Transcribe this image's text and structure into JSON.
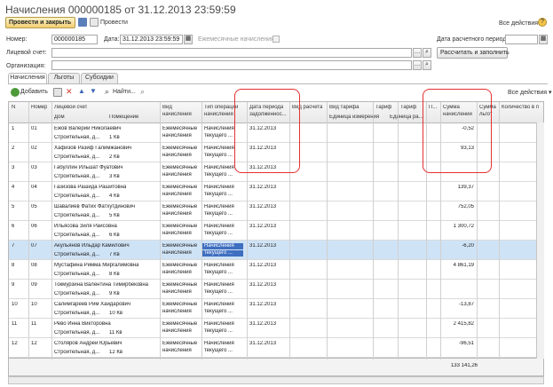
{
  "window": {
    "title": "Начисления 000000185 от 31.12.2013 23:59:59"
  },
  "toolbar": {
    "post_close": "Провести и закрыть",
    "post": "Провести",
    "all_actions": "Все действия ▾",
    "help": "?"
  },
  "form": {
    "number_label": "Номер:",
    "number_value": "000000185",
    "date_label": "Дата:",
    "date_value": "31.12.2013 23:59:59",
    "monthly_label": "Ежемесячные начисления:",
    "calc_period_label": "Дата расчетного периода:",
    "account_label": "Лицевой счет:",
    "org_label": "Организация:",
    "calc_fill_button": "Рассчитать и заполнить"
  },
  "tabs": [
    "Начисления",
    "Льготы",
    "Субсидии"
  ],
  "grid_toolbar": {
    "add": "Добавить",
    "find": "Найти...",
    "all_actions": "Все действия ▾"
  },
  "columns": {
    "n": "N",
    "num": "Номер",
    "account": "Лицевой счет",
    "house": "Дом",
    "room": "Помещение",
    "kind_1": "Вид",
    "kind_2": "начисления",
    "optype_1": "Тип операции",
    "optype_2": "начисления",
    "period_1": "Дата периода",
    "period_2": "задолженнос...",
    "calc_kind": "Вид расчета",
    "tariff_kind": "Вид тарифа",
    "unit": "Единица измерения",
    "tariff": "Тариф",
    "tariff_unit": "Тариф",
    "tariff_unit2": "Единица ра...",
    "p": "П...",
    "sum_1": "Сумма",
    "sum_2": "начислений",
    "sum_lg_1": "Сумма",
    "sum_lg_2": "льгот",
    "qty": "Количество в п"
  },
  "rows": [
    {
      "n": "1",
      "num": "01",
      "name": "Ежов Валерий Николаевич",
      "house": "Строительная, д...",
      "room": "1 Кв",
      "kind": "Ежемесячные",
      "kind2": "начисления",
      "op": "Начисления",
      "op2": "текущего ...",
      "period": "31.12.2013",
      "sum": "-0,52"
    },
    {
      "n": "2",
      "num": "02",
      "name": "Хафизов Разиф Галимжанович",
      "house": "Строительная, д...",
      "room": "2 Кв",
      "kind": "Ежемесячные",
      "kind2": "начисления",
      "op": "Начисления",
      "op2": "текущего ...",
      "period": "31.12.2013",
      "sum": "93,13"
    },
    {
      "n": "3",
      "num": "03",
      "name": "Габуллин Ильшат Фуатович",
      "house": "Строительная, д...",
      "room": "3 Кв",
      "kind": "Ежемесячные",
      "kind2": "начисления",
      "op": "Начисления",
      "op2": "текущего ...",
      "period": "31.12.2013",
      "sum": ""
    },
    {
      "n": "4",
      "num": "04",
      "name": "Газизова Рашида Рашитовна",
      "house": "Строительная, д...",
      "room": "4 Кв",
      "kind": "Ежемесячные",
      "kind2": "начисления",
      "op": "Начисления",
      "op2": "текущего ...",
      "period": "31.12.2013",
      "sum": "139,37"
    },
    {
      "n": "5",
      "num": "05",
      "name": "Шавалиев Фатих Фатхутдинович",
      "house": "Строительная, д...",
      "room": "5 Кв",
      "kind": "Ежемесячные",
      "kind2": "начисления",
      "op": "Начисления",
      "op2": "текущего ...",
      "period": "31.12.2013",
      "sum": "752,05"
    },
    {
      "n": "6",
      "num": "06",
      "name": "Ильясова Зиля Раисовна",
      "house": "Строительная, д...",
      "room": "6 Кв",
      "kind": "Ежемесячные",
      "kind2": "начисления",
      "op": "Начисления",
      "op2": "текущего ...",
      "period": "31.12.2013",
      "sum": "1 300,72"
    },
    {
      "n": "7",
      "num": "07",
      "name": "Акульянов Ильдар Камилович",
      "house": "Строительная, д...",
      "room": "7 Кв",
      "kind": "Ежемесячные",
      "kind2": "начисления",
      "op": "Начисления",
      "op2": "текущего ...",
      "period": "31.12.2013",
      "sum": "-6,20"
    },
    {
      "n": "8",
      "num": "08",
      "name": "Мустафина Римма Миргалимовна",
      "house": "Строительная, д...",
      "room": "8 Кв",
      "kind": "Ежемесячные",
      "kind2": "начисления",
      "op": "Начисления",
      "op2": "текущего ...",
      "period": "31.12.2013",
      "sum": "4 861,19"
    },
    {
      "n": "9",
      "num": "09",
      "name": "Токмурзина Валентина Тимирбековна",
      "house": "Строительная, д...",
      "room": "9 Кв",
      "kind": "Ежемесячные",
      "kind2": "начисления",
      "op": "Начисления",
      "op2": "текущего ...",
      "period": "31.12.2013",
      "sum": ""
    },
    {
      "n": "10",
      "num": "10",
      "name": "Салимгареев Рим Хайдарович",
      "house": "Строительная, д...",
      "room": "10 Кв",
      "kind": "Ежемесячные",
      "kind2": "начисления",
      "op": "Начисления",
      "op2": "текущего ...",
      "period": "31.12.2013",
      "sum": "-13,87"
    },
    {
      "n": "11",
      "num": "11",
      "name": "Рево Инна Викторовна",
      "house": "Строительная, д...",
      "room": "11 Кв",
      "kind": "Ежемесячные",
      "kind2": "начисления",
      "op": "Начисления",
      "op2": "текущего ...",
      "period": "31.12.2013",
      "sum": "2 415,82"
    },
    {
      "n": "12",
      "num": "12",
      "name": "Столяров Андрей Юрьевич",
      "house": "Строительная, д...",
      "room": "12 Кв",
      "kind": "Ежемесячные",
      "kind2": "начисления",
      "op": "Начисления",
      "op2": "текущего ...",
      "period": "31.12.2013",
      "sum": "-96,51"
    }
  ],
  "total_sum": "133 141,26",
  "selected_row": 6
}
